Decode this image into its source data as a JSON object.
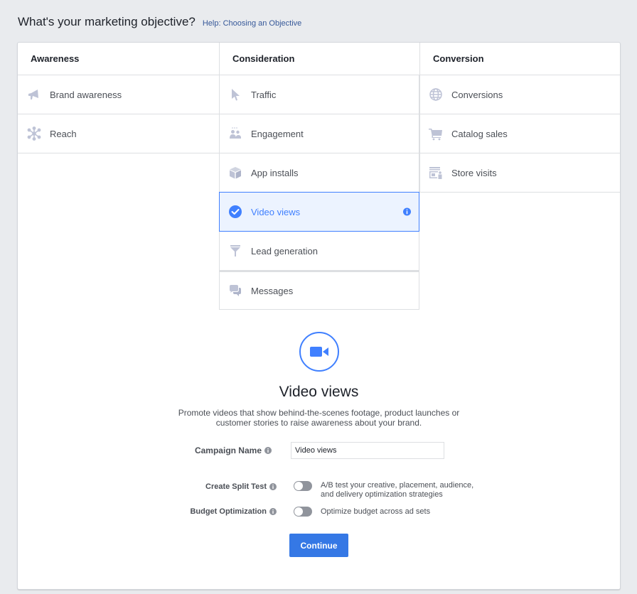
{
  "header": {
    "title": "What's your marketing objective?",
    "help_link": "Help: Choosing an Objective"
  },
  "columns": [
    {
      "title": "Awareness",
      "items": [
        {
          "label": "Brand awareness",
          "icon": "megaphone-icon"
        },
        {
          "label": "Reach",
          "icon": "reach-network-icon"
        }
      ]
    },
    {
      "title": "Consideration",
      "items": [
        {
          "label": "Traffic",
          "icon": "cursor-icon"
        },
        {
          "label": "Engagement",
          "icon": "people-icon"
        },
        {
          "label": "App installs",
          "icon": "box-icon"
        },
        {
          "label": "Video views",
          "icon": "checkmark-circle-icon",
          "selected": true
        },
        {
          "label": "Lead generation",
          "icon": "funnel-icon"
        },
        {
          "label": "Messages",
          "icon": "chat-bubbles-icon"
        }
      ]
    },
    {
      "title": "Conversion",
      "items": [
        {
          "label": "Conversions",
          "icon": "globe-icon"
        },
        {
          "label": "Catalog sales",
          "icon": "cart-icon"
        },
        {
          "label": "Store visits",
          "icon": "store-icon"
        }
      ]
    }
  ],
  "detail": {
    "icon": "video-camera-icon",
    "title": "Video views",
    "description": "Promote videos that show behind-the-scenes footage, product launches or customer stories to raise awareness about your brand."
  },
  "form": {
    "campaign_name_label": "Campaign Name",
    "campaign_name_value": "Video views",
    "split_test_label": "Create Split Test",
    "split_test_desc": "A/B test your creative, placement, audience, and delivery optimization strategies",
    "split_test_on": false,
    "budget_label": "Budget Optimization",
    "budget_desc": "Optimize budget across ad sets",
    "budget_on": false,
    "continue_label": "Continue"
  },
  "colors": {
    "accent": "#4080ff",
    "button": "#3578e5",
    "selected_bg": "#ecf3ff",
    "icon_gray": "#bec3d6"
  }
}
